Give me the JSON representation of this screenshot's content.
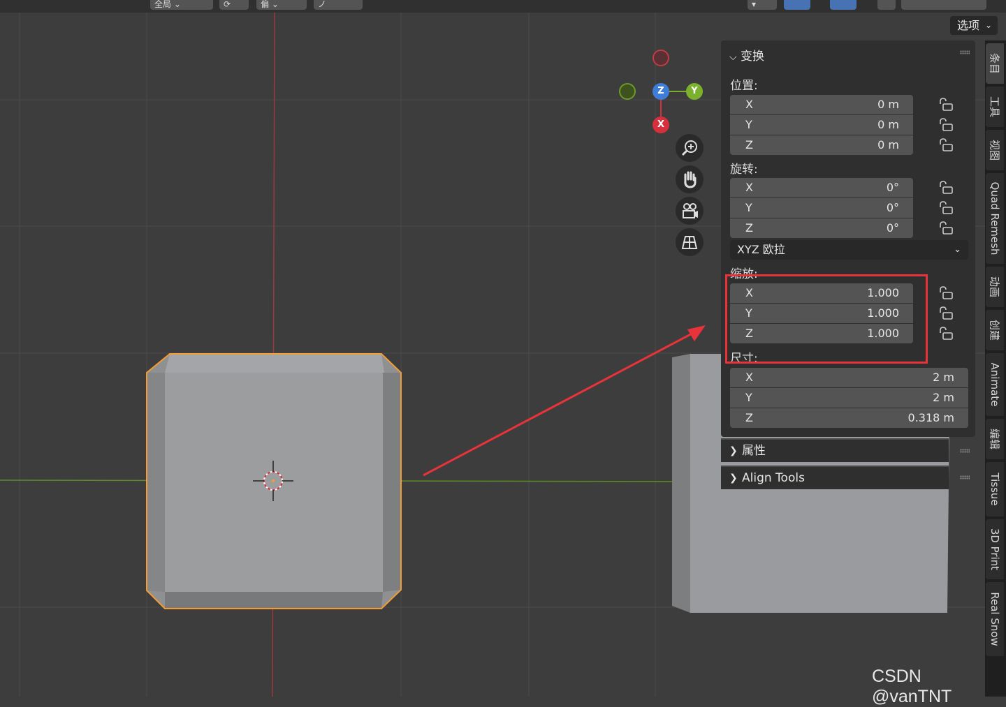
{
  "header": {
    "tools": [
      "全局",
      "⟳",
      "偏",
      "ノ"
    ]
  },
  "viewport": {
    "options_label": "选项",
    "gizmo": {
      "z_label": "Z",
      "y_label": "Y",
      "x_label": "X"
    }
  },
  "panel": {
    "transform_title": "变换",
    "location_label": "位置:",
    "location": [
      {
        "axis": "X",
        "value": "0 m"
      },
      {
        "axis": "Y",
        "value": "0 m"
      },
      {
        "axis": "Z",
        "value": "0 m"
      }
    ],
    "rotation_label": "旋转:",
    "rotation": [
      {
        "axis": "X",
        "value": "0°"
      },
      {
        "axis": "Y",
        "value": "0°"
      },
      {
        "axis": "Z",
        "value": "0°"
      }
    ],
    "rotation_mode": "XYZ 欧拉",
    "scale_label": "缩放:",
    "scale": [
      {
        "axis": "X",
        "value": "1.000"
      },
      {
        "axis": "Y",
        "value": "1.000"
      },
      {
        "axis": "Z",
        "value": "1.000"
      }
    ],
    "dimensions_label": "尺寸:",
    "dimensions": [
      {
        "axis": "X",
        "value": "2 m"
      },
      {
        "axis": "Y",
        "value": "2 m"
      },
      {
        "axis": "Z",
        "value": "0.318 m"
      }
    ],
    "properties_title": "属性",
    "align_tools_title": "Align Tools"
  },
  "sidebar_tabs": [
    "条目",
    "工具",
    "视图",
    "Quad Remesh",
    "动画",
    "创建",
    "Animate",
    "编辑",
    "Tissue",
    "3D Print",
    "Real Snow"
  ],
  "watermark": "CSDN @vanTNT",
  "colors": {
    "selection_outline": "#f39c35",
    "highlight_box": "#e8333a",
    "annotation_arrow": "#e8333a",
    "x_axis_line": "#9a3a3e",
    "y_axis_line": "#5f8a28"
  }
}
